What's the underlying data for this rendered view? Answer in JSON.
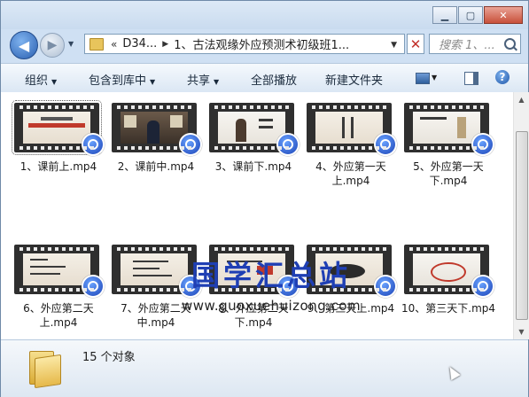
{
  "window": {
    "buttons": {
      "minimize": "▁",
      "maximize": "▢",
      "close": "✕"
    }
  },
  "nav": {
    "back": "◀",
    "forward": "▶",
    "address_segments": [
      "«",
      "D34...",
      "1、古法观缘外应预测术初级班1..."
    ],
    "search_placeholder": "搜索 1、..."
  },
  "toolbar": {
    "organize": "组织",
    "include_library": "包含到库中",
    "share": "共享",
    "play_all": "全部播放",
    "new_folder": "新建文件夹"
  },
  "files": [
    {
      "name": "1、课前上.mp4",
      "style": "paper"
    },
    {
      "name": "2、课前中.mp4",
      "style": "room"
    },
    {
      "name": "3、课前下.mp4",
      "style": "light"
    },
    {
      "name": "4、外应第一天上.mp4",
      "style": "paper"
    },
    {
      "name": "5、外应第一天下.mp4",
      "style": "light"
    },
    {
      "name": "6、外应第二天上.mp4",
      "style": "paper"
    },
    {
      "name": "7、外应第二天中.mp4",
      "style": "paper"
    },
    {
      "name": "8、外应第二天下.mp4",
      "style": "paper"
    },
    {
      "name": "9、第三天上.mp4",
      "style": "paper"
    },
    {
      "name": "10、第三天下.mp4",
      "style": "light"
    }
  ],
  "watermark": {
    "title": "国学汇总站",
    "url": "www.guoxuehuizong.com"
  },
  "details": {
    "count_text": "15 个对象"
  },
  "icons": [
    "back-arrow-icon",
    "forward-arrow-icon",
    "folder-icon",
    "search-icon",
    "view-icon",
    "preview-pane-icon",
    "help-icon",
    "play-badge-icon"
  ]
}
